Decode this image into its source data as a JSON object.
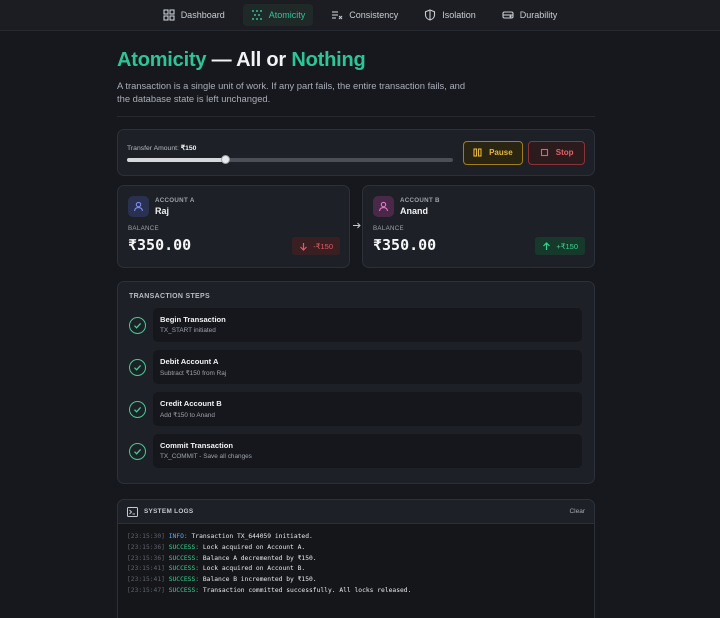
{
  "nav": [
    {
      "label": "Dashboard",
      "icon": "dashboard-icon"
    },
    {
      "label": "Atomicity",
      "icon": "atom-icon",
      "active": true
    },
    {
      "label": "Consistency",
      "icon": "consistency-icon"
    },
    {
      "label": "Isolation",
      "icon": "shield-icon"
    },
    {
      "label": "Durability",
      "icon": "disk-icon"
    }
  ],
  "hero": {
    "title_word1": "Atomicity",
    "title_mid": " — All or ",
    "title_word2": "Nothing",
    "description": "A transaction is a single unit of work. If any part fails, the entire transaction fails, and the database state is left unchanged."
  },
  "transfer": {
    "label": "Transfer Amount:",
    "amount": "₹150",
    "slider_level": 0.3,
    "pause_label": "Pause",
    "stop_label": "Stop"
  },
  "accounts": [
    {
      "kicker": "ACCOUNT A",
      "name": "Raj",
      "balance_label": "BALANCE",
      "balance": "₹350.00",
      "delta": "-₹150",
      "icon": "user-icon"
    },
    {
      "kicker": "ACCOUNT B",
      "name": "Anand",
      "balance_label": "BALANCE",
      "balance": "₹350.00",
      "delta": "+₹150",
      "icon": "user-icon"
    }
  ],
  "steps": {
    "title": "TRANSACTION STEPS",
    "items": [
      {
        "title": "Begin Transaction",
        "sub": "TX_START initiated"
      },
      {
        "title": "Debit Account A",
        "sub": "Subtract ₹150 from Raj"
      },
      {
        "title": "Credit Account B",
        "sub": "Add ₹150 to Anand"
      },
      {
        "title": "Commit Transaction",
        "sub": "TX_COMMIT - Save all changes"
      }
    ]
  },
  "logs": {
    "title": "SYSTEM LOGS",
    "clear_label": "Clear",
    "lines": [
      {
        "ts": "[23:15:30]",
        "level": "INFO:",
        "msg": "Transaction TX_644059 initiated."
      },
      {
        "ts": "[23:15:36]",
        "level": "SUCCESS:",
        "msg": "Lock acquired on Account A."
      },
      {
        "ts": "[23:15:36]",
        "level": "SUCCESS:",
        "msg": "Balance A decremented by ₹150."
      },
      {
        "ts": "[23:15:41]",
        "level": "SUCCESS:",
        "msg": "Lock acquired on Account B."
      },
      {
        "ts": "[23:15:41]",
        "level": "SUCCESS:",
        "msg": "Balance B incremented by ₹150."
      },
      {
        "ts": "[23:15:47]",
        "level": "SUCCESS:",
        "msg": "Transaction committed successfully. All locks released."
      }
    ]
  },
  "colors": {
    "accent": "#2ec498",
    "success": "#37d48f",
    "danger": "#e45a62",
    "warning": "#e5b73a",
    "info": "#5aa8f0"
  }
}
